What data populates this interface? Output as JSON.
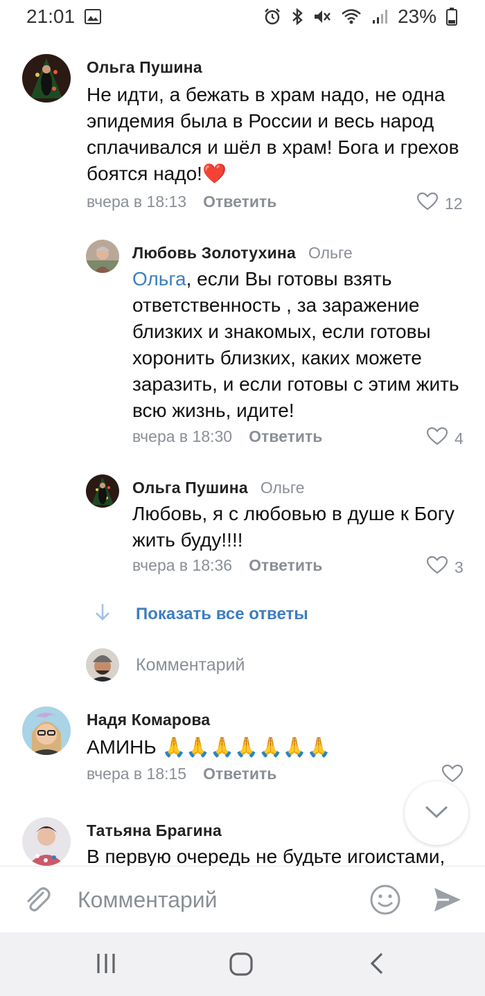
{
  "status_bar": {
    "time": "21:01",
    "battery": "23%",
    "icons": [
      "image-icon",
      "alarm-icon",
      "bluetooth-icon",
      "mute-icon",
      "wifi-icon",
      "signal-icon",
      "battery-icon"
    ]
  },
  "comments": [
    {
      "author": "Ольга Пушина",
      "text": "Не идти, а бежать в храм надо, не одна эпидемия была в России и весь народ сплачивался и шёл в храм! Бога и грехов боятся надо!❤️",
      "time": "вчера в 18:13",
      "reply_label": "Ответить",
      "likes": "12"
    },
    {
      "author": "Любовь Золотухина",
      "reply_to": "Ольге",
      "mention": "Ольга",
      "text": ", если Вы готовы взять ответственность , за заражение близких и знакомых, если готовы хоронить близких, каких можете заразить, и если готовы с этим жить всю жизнь, идите!",
      "time": "вчера в 18:30",
      "reply_label": "Ответить",
      "likes": "4"
    },
    {
      "author": "Ольга Пушина",
      "reply_to": "Ольге",
      "text": "Любовь, я с любовью в душе к Богу жить буду!!!!",
      "time": "вчера в 18:36",
      "reply_label": "Ответить",
      "likes": "3"
    },
    {
      "author": "Надя Комарова",
      "text": "АМИНЬ 🙏🙏🙏🙏🙏🙏🙏",
      "time": "вчера в 18:15",
      "reply_label": "Ответить",
      "likes": ""
    },
    {
      "author": "Татьяна Брагина",
      "text": "В первую очередь не будьте игоистами,"
    }
  ],
  "show_all_replies": "Показать все ответы",
  "inline_reply_placeholder": "Комментарий",
  "composer": {
    "placeholder": "Комментарий"
  },
  "colors": {
    "link": "#3f7dc0",
    "meta": "#8a8f96"
  }
}
